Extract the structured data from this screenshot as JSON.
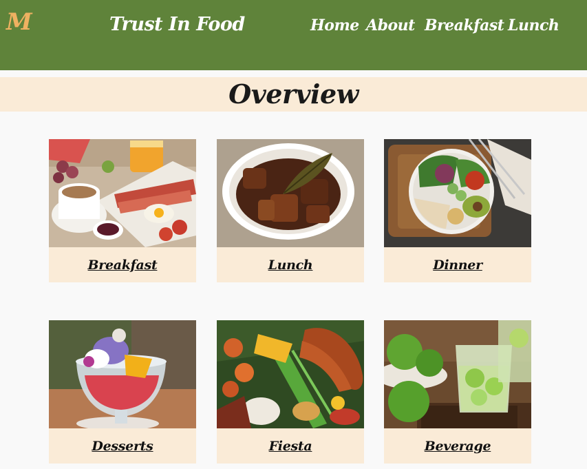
{
  "header": {
    "logo": "M",
    "title": "Trust In Food",
    "nav": [
      "Home",
      "About",
      "Breakfast",
      "Lunch"
    ]
  },
  "overview": {
    "title": "Overview"
  },
  "cards": [
    {
      "label": "Breakfast",
      "image": "breakfast-photo"
    },
    {
      "label": "Lunch",
      "image": "lunch-photo"
    },
    {
      "label": "Dinner",
      "image": "dinner-photo"
    },
    {
      "label": "Desserts",
      "image": "desserts-photo"
    },
    {
      "label": "Fiesta",
      "image": "fiesta-photo"
    },
    {
      "label": "Beverage",
      "image": "beverage-photo"
    }
  ],
  "colors": {
    "header_bg": "#5f833a",
    "logo": "#efb161",
    "section_bg": "#faebd7",
    "page_bg": "#f9f9f9"
  }
}
